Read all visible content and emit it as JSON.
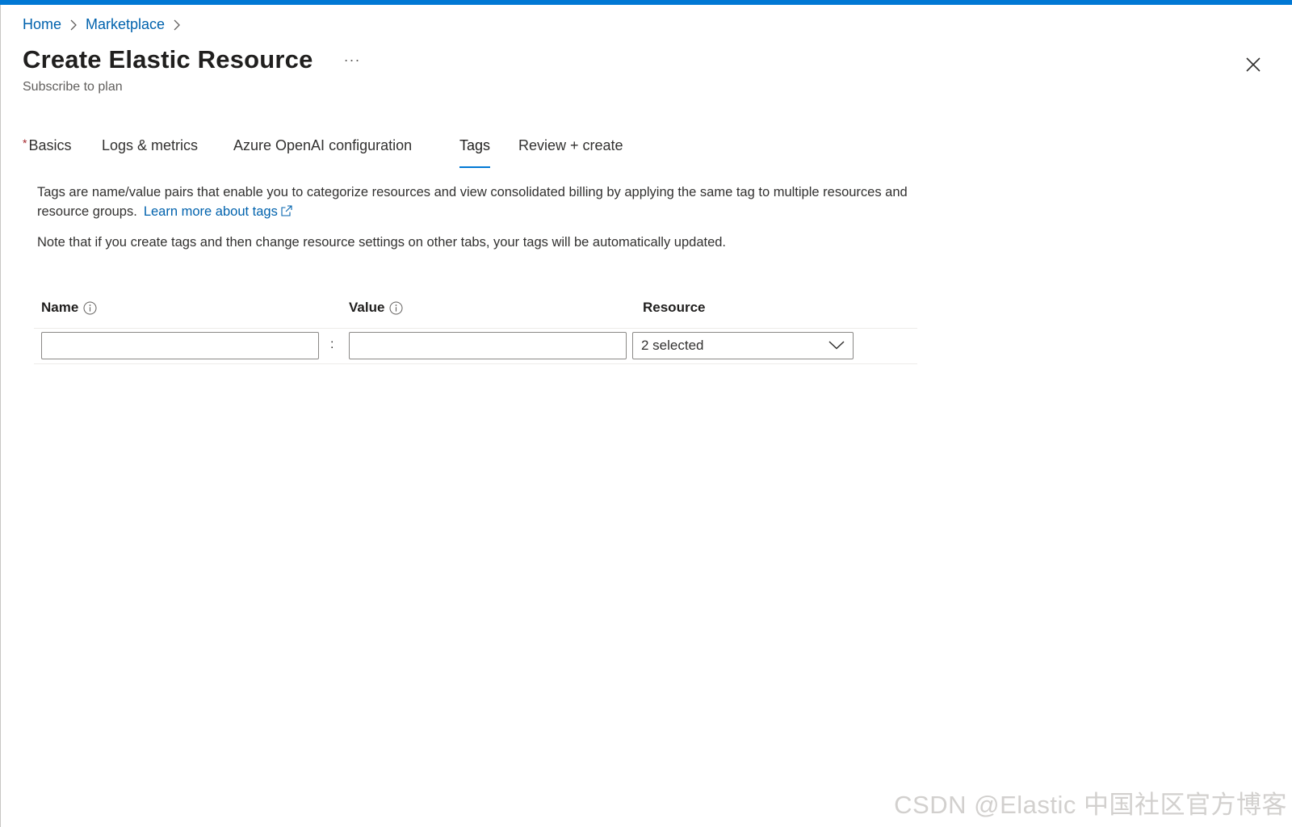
{
  "breadcrumb": {
    "home": "Home",
    "marketplace": "Marketplace"
  },
  "header": {
    "title": "Create Elastic Resource",
    "more": "···",
    "subtitle": "Subscribe to plan"
  },
  "tabs": [
    {
      "label": "Basics",
      "required": true,
      "active": false
    },
    {
      "label": "Logs & metrics",
      "required": false,
      "active": false
    },
    {
      "label": "Azure OpenAI configuration",
      "required": false,
      "active": false
    },
    {
      "label": "Tags",
      "required": false,
      "active": true
    },
    {
      "label": "Review + create",
      "required": false,
      "active": false
    }
  ],
  "required_marker": "*",
  "content": {
    "description": "Tags are name/value pairs that enable you to categorize resources and view consolidated billing by applying the same tag to multiple resources and resource groups.",
    "learn_more": "Learn more about tags",
    "note": "Note that if you create tags and then change resource settings on other tabs, your tags will be automatically updated."
  },
  "tags_grid": {
    "columns": {
      "name": "Name",
      "value": "Value",
      "resource": "Resource"
    },
    "rows": [
      {
        "name": "",
        "separator": ":",
        "value": "",
        "resource": "2 selected"
      }
    ]
  },
  "icons": {
    "breadcrumb_separator": "chevron-right-icon",
    "close": "close-icon",
    "info": "info-icon",
    "external_link": "external-link-icon",
    "dropdown": "chevron-down-icon"
  },
  "colors": {
    "accent": "#0078d4",
    "link": "#0062ad",
    "required": "#a4262c"
  },
  "watermark": "CSDN @Elastic 中国社区官方博客"
}
